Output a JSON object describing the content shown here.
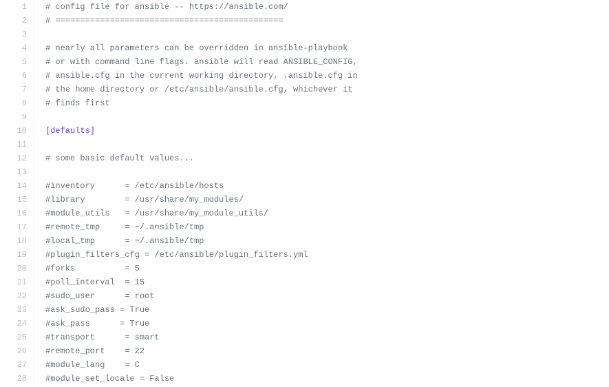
{
  "lines": [
    {
      "num": 1,
      "text": "# config file for ansible -- https://ansible.com/",
      "type": "comment"
    },
    {
      "num": 2,
      "text": "# ==============================================",
      "type": "comment"
    },
    {
      "num": 3,
      "text": "",
      "type": "blank"
    },
    {
      "num": 4,
      "text": "# nearly all parameters can be overridden in ansible-playbook",
      "type": "comment"
    },
    {
      "num": 5,
      "text": "# or with command line flags. ansible will read ANSIBLE_CONFIG,",
      "type": "comment"
    },
    {
      "num": 6,
      "text": "# ansible.cfg in the current working directory, .ansible.cfg in",
      "type": "comment"
    },
    {
      "num": 7,
      "text": "# the home directory or /etc/ansible/ansible.cfg, whichever it",
      "type": "comment"
    },
    {
      "num": 8,
      "text": "# finds first",
      "type": "comment"
    },
    {
      "num": 9,
      "text": "",
      "type": "blank"
    },
    {
      "num": 10,
      "text": "[defaults]",
      "type": "section"
    },
    {
      "num": 11,
      "text": "",
      "type": "blank"
    },
    {
      "num": 12,
      "text": "# some basic default values...",
      "type": "comment"
    },
    {
      "num": 13,
      "text": "",
      "type": "blank"
    },
    {
      "num": 14,
      "text": "#inventory      = /etc/ansible/hosts",
      "type": "comment"
    },
    {
      "num": 15,
      "text": "#library        = /usr/share/my_modules/",
      "type": "comment"
    },
    {
      "num": 16,
      "text": "#module_utils   = /usr/share/my_module_utils/",
      "type": "comment"
    },
    {
      "num": 17,
      "text": "#remote_tmp     = ~/.ansible/tmp",
      "type": "comment"
    },
    {
      "num": 18,
      "text": "#local_tmp      = ~/.ansible/tmp",
      "type": "comment"
    },
    {
      "num": 19,
      "text": "#plugin_filters_cfg = /etc/ansible/plugin_filters.yml",
      "type": "comment"
    },
    {
      "num": 20,
      "text": "#forks          = 5",
      "type": "comment"
    },
    {
      "num": 21,
      "text": "#poll_interval  = 15",
      "type": "comment"
    },
    {
      "num": 22,
      "text": "#sudo_user      = root",
      "type": "comment"
    },
    {
      "num": 23,
      "text": "#ask_sudo_pass = True",
      "type": "comment"
    },
    {
      "num": 24,
      "text": "#ask_pass      = True",
      "type": "comment"
    },
    {
      "num": 25,
      "text": "#transport      = smart",
      "type": "comment"
    },
    {
      "num": 26,
      "text": "#remote_port    = 22",
      "type": "comment"
    },
    {
      "num": 27,
      "text": "#module_lang    = C",
      "type": "comment"
    },
    {
      "num": 28,
      "text": "#module_set_locale = False",
      "type": "comment"
    }
  ]
}
